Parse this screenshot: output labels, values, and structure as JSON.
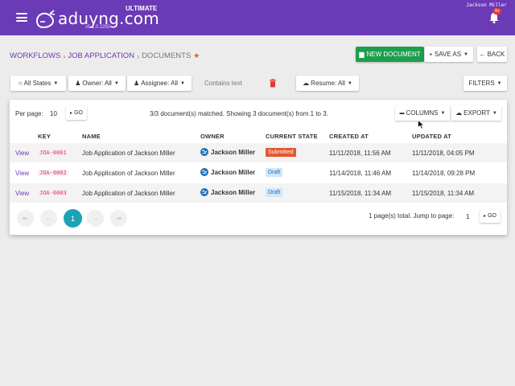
{
  "header": {
    "logo_text": "aduyng.com",
    "logo_tier": "ULTIMATE",
    "version": "v5.1.0.2292",
    "username": "Jackson Miller",
    "notification_badge": "9+"
  },
  "breadcrumb": {
    "items": [
      "WORKFLOWS",
      "JOB APPLICATION"
    ],
    "current": "DOCUMENTS"
  },
  "toolbar": {
    "new_document": "NEW DOCUMENT",
    "save_as": "SAVE AS",
    "back": "BACK"
  },
  "filters": {
    "states": "All States",
    "owner": "Owner: All",
    "assignee": "Assignee: All",
    "text_placeholder": "Contains text",
    "resume": "Resume: All",
    "filters_button": "FILTERS"
  },
  "table_toolbar": {
    "per_page_label": "Per page:",
    "per_page_value": "10",
    "go_label": "GO",
    "matched_text": "3/3 document(s) matched. Showing 3 document(s) from 1 to 3.",
    "columns_label": "COLUMNS",
    "export_label": "EXPORT"
  },
  "table": {
    "headers": [
      "KEY",
      "NAME",
      "OWNER",
      "CURRENT STATE",
      "CREATED AT",
      "UPDATED AT"
    ],
    "rows": [
      {
        "action": "View",
        "key": "JOA-0001",
        "name": "Job Application of Jackson Miller",
        "owner": "Jackson Miller",
        "state": "Submitted",
        "created": "11/11/2018, 11:56 AM",
        "updated": "11/11/2018, 04:05 PM"
      },
      {
        "action": "View",
        "key": "JOA-0002",
        "name": "Job Application of Jackson Miller",
        "owner": "Jackson Miller",
        "state": "Draft",
        "created": "11/14/2018, 11:46 AM",
        "updated": "11/14/2018, 09:28 PM"
      },
      {
        "action": "View",
        "key": "JOA-0003",
        "name": "Job Application of Jackson Miller",
        "owner": "Jackson Miller",
        "state": "Draft",
        "created": "11/15/2018, 11:34 AM",
        "updated": "11/15/2018, 11:34 AM"
      }
    ]
  },
  "pagination": {
    "current_page": "1",
    "total_text": "1 page(s) total. Jump to page:",
    "jump_value": "1",
    "go_label": "GO"
  },
  "colors": {
    "brand": "#6a3ab7",
    "success": "#1e9e4c",
    "submitted": "#e4572e",
    "draft_bg": "#cfe7fb",
    "page_active": "#1ca3b3"
  }
}
